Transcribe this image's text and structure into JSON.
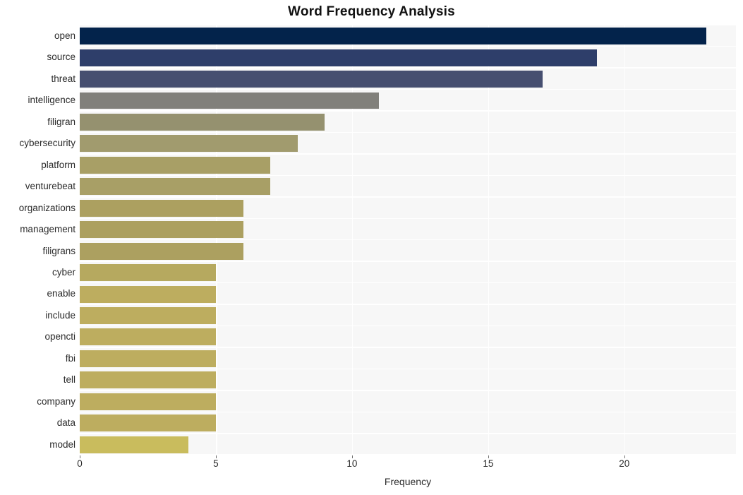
{
  "chart_data": {
    "type": "bar",
    "orientation": "horizontal",
    "title": "Word Frequency Analysis",
    "xlabel": "Frequency",
    "ylabel": "",
    "categories": [
      "open",
      "source",
      "threat",
      "intelligence",
      "filigran",
      "cybersecurity",
      "platform",
      "venturebeat",
      "organizations",
      "management",
      "filigrans",
      "cyber",
      "enable",
      "include",
      "opencti",
      "fbi",
      "tell",
      "company",
      "data",
      "model"
    ],
    "values": [
      23,
      19,
      17,
      11,
      9,
      8,
      7,
      7,
      6,
      6,
      6,
      5,
      5,
      5,
      5,
      5,
      5,
      5,
      5,
      4
    ],
    "bar_colors": [
      "#04244c",
      "#2f3f६b",
      "#2f3f6b",
      "#47527100",
      "#80807b",
      "#94906f",
      "#a09a6f",
      "#a89f66",
      "#a89f66",
      "#ab9f60",
      "#ab9f60",
      "#b3a55f",
      "#bdad5f",
      "#bdad5f",
      "#bdad5f",
      "#bdad5f",
      "#bdad5f",
      "#bdad5f",
      "#bdad5f",
      "#c8bc5f"
    ],
    "xlim": [
      0,
      24.1
    ],
    "xticks": [
      0,
      5,
      10,
      15,
      20
    ],
    "xticklabels": [
      "0",
      "5",
      "10",
      "15",
      "20"
    ],
    "grid": "vertical-white-on-gray",
    "plot_background": "#f7f7f7",
    "figure_background": "#ffffff"
  },
  "colors": {
    "bars": [
      "#03234b",
      "#2e3e6a",
      "#464f70",
      "#81807b",
      "#95916f",
      "#a19b6e",
      "#a89f66",
      "#a89f66",
      "#aca060",
      "#aca060",
      "#aca060",
      "#b6a95f",
      "#bdad5f",
      "#bdad5f",
      "#bdad5f",
      "#bdad5f",
      "#bdad5f",
      "#bdad5f",
      "#bdad5f",
      "#c9bc5d"
    ],
    "title_text": "#111111",
    "tick_text": "#2b2b2b",
    "plot_bg": "#f7f7f7",
    "gridline": "#ffffff"
  }
}
